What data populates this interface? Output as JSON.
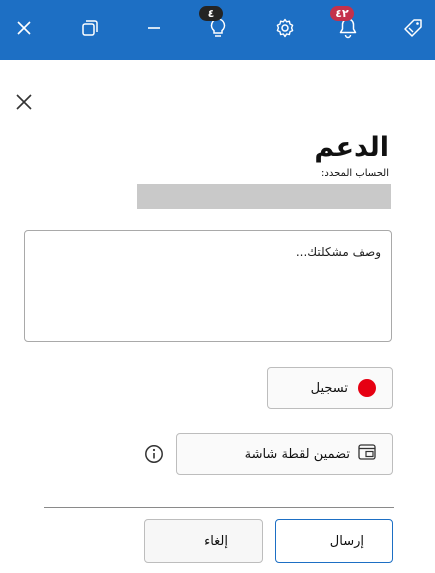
{
  "colors": {
    "titlebar": "#1d6fc4",
    "badge_red": "#c4314b",
    "record_dot": "#e60012",
    "send_border": "#1d6fc4"
  },
  "titlebar": {
    "notifications_badge": "٤٢",
    "ideas_badge": "٤"
  },
  "support": {
    "title": "الدعم",
    "account_label": "الحساب المحدد:",
    "description_placeholder": "وصف مشكلتك...",
    "record_label": "تسجيل",
    "screenshot_label": "تضمين لقطة شاشة",
    "send_label": "إرسال",
    "cancel_label": "إلغاء"
  }
}
